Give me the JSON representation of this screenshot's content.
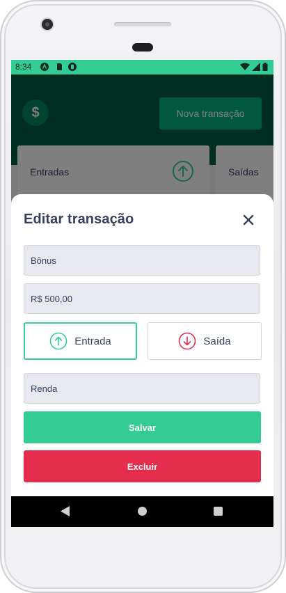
{
  "statusbar": {
    "time": "8:34",
    "icons": [
      "app-a-icon",
      "sd-card-icon",
      "sync-icon",
      "wifi-icon",
      "signal-icon",
      "battery-icon"
    ]
  },
  "background_app": {
    "logo_symbol": "$",
    "new_transaction_label": "Nova transação",
    "cards": [
      {
        "title": "Entradas",
        "icon": "arrow-up-circle-icon"
      },
      {
        "title": "Saídas"
      }
    ]
  },
  "modal": {
    "title": "Editar transação",
    "close_icon": "close-icon",
    "fields": {
      "title_value": "Bônus",
      "amount_value": "R$ 500,00",
      "category_value": "Renda"
    },
    "type_options": [
      {
        "label": "Entrada",
        "icon": "arrow-up-circle-icon",
        "selected": true,
        "color": "#33cc95"
      },
      {
        "label": "Saída",
        "icon": "arrow-down-circle-icon",
        "selected": false,
        "color": "#e52e4d"
      }
    ],
    "save_label": "Salvar",
    "delete_label": "Excluir"
  },
  "colors": {
    "accent_green": "#33cc95",
    "danger_red": "#e52e4d",
    "header_green": "#015f43",
    "text_dark": "#363f5f"
  },
  "navbar": {
    "icons": [
      "back-icon",
      "home-icon",
      "recents-icon"
    ]
  }
}
